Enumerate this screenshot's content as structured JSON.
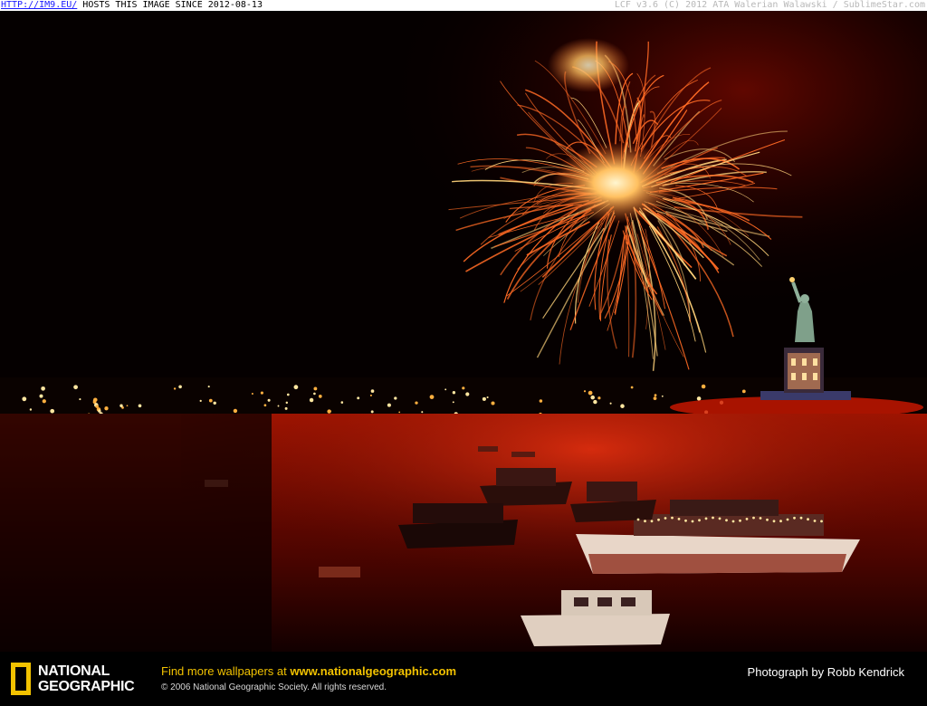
{
  "watermark": {
    "link_text": "HTTP://IM9.EU/",
    "since_text": "HOSTS THIS IMAGE SINCE 2012-08-13",
    "right_text": "LCF v3.6 (C) 2012 ATA Walerian Walawski / SublimeStar.com"
  },
  "photo": {
    "subject": "fireworks-over-statue-of-liberty",
    "colors": {
      "sky": "#050000",
      "firework": "#ff5a1a",
      "glow": "#c01000",
      "water": "#7a0a00"
    }
  },
  "caption": {
    "logo_line1": "NATIONAL",
    "logo_line2": "GEOGRAPHIC",
    "promo_prefix": "Find more wallpapers at ",
    "promo_url": "www.nationalgeographic.com",
    "copyright": "© 2006 National Geographic Society. All rights reserved.",
    "credit": "Photograph by Robb Kendrick",
    "colors": {
      "accent": "#f2c200"
    }
  }
}
